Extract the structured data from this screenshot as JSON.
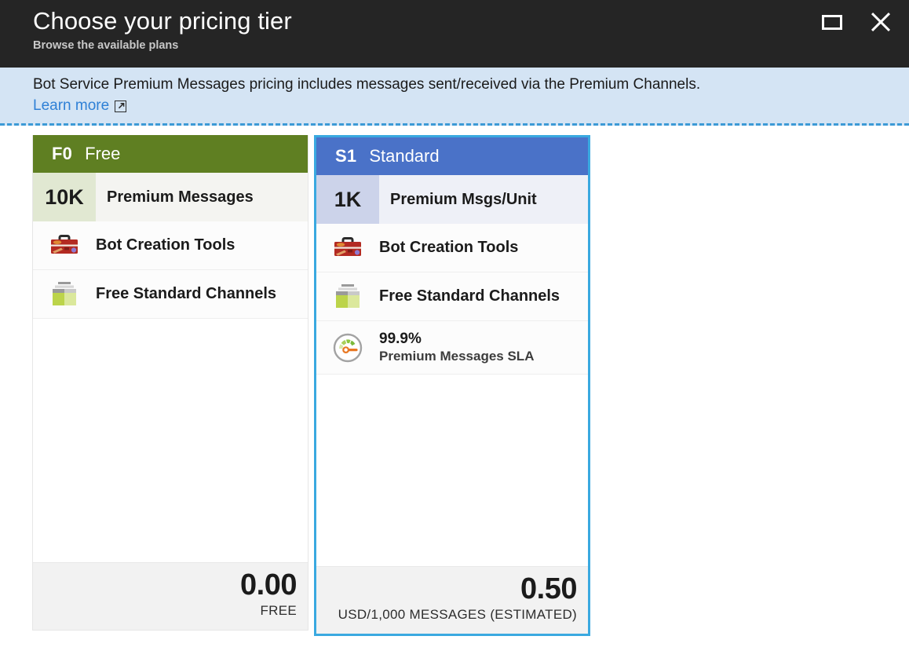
{
  "titlebar": {
    "title": "Choose your pricing tier",
    "subtitle": "Browse the available plans",
    "restore_label": "restore-window",
    "close_label": "close-window"
  },
  "banner": {
    "text": "Bot Service Premium Messages pricing includes messages sent/received via the Premium Channels.",
    "link_label": "Learn more",
    "link_icon": "external-link-icon",
    "background": "#d4e4f4",
    "border_color": "#3d9ad6"
  },
  "cards": [
    {
      "code": "F0",
      "name": "Free",
      "header_color": "#5f7f22",
      "selected": false,
      "quota": {
        "value": "10K",
        "label": "Premium Messages"
      },
      "features": [
        {
          "icon": "toolbox-icon",
          "label": "Bot Creation Tools"
        },
        {
          "icon": "package-stack-icon",
          "label": "Free Standard Channels"
        }
      ],
      "price": "0.00",
      "price_unit": "FREE"
    },
    {
      "code": "S1",
      "name": "Standard",
      "header_color": "#4a72c8",
      "selected": true,
      "selection_color": "#3aa9e0",
      "quota": {
        "value": "1K",
        "label": "Premium Msgs/Unit"
      },
      "features": [
        {
          "icon": "toolbox-icon",
          "label": "Bot Creation Tools"
        },
        {
          "icon": "package-stack-icon",
          "label": "Free Standard Channels"
        },
        {
          "icon": "gauge-icon",
          "big": "99.9%",
          "sub": "Premium Messages SLA"
        }
      ],
      "price": "0.50",
      "price_unit": "USD/1,000 MESSAGES (ESTIMATED)"
    }
  ]
}
